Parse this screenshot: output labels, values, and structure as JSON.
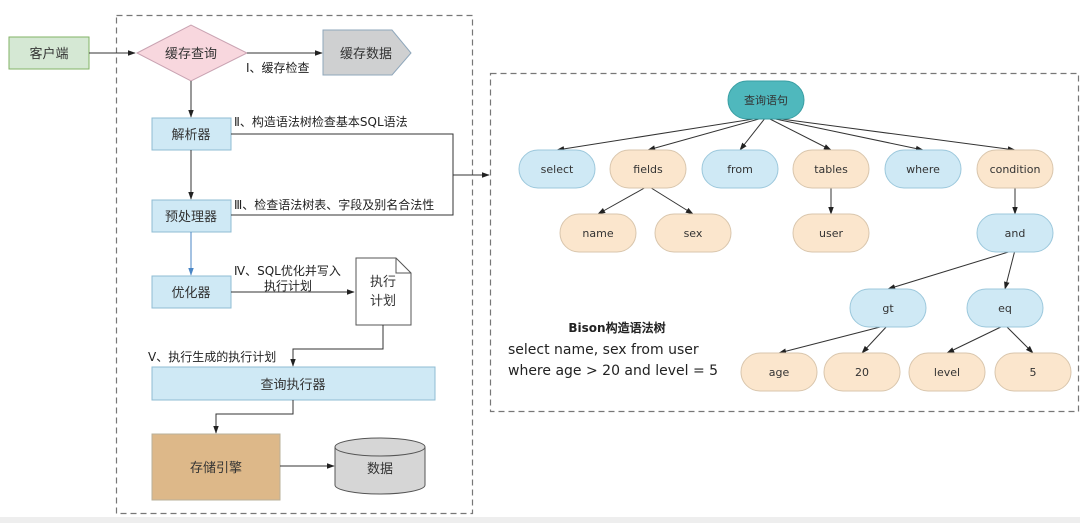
{
  "colors": {
    "client": "#d5e8d4",
    "client_border": "#82b366",
    "cache_query": "#f8d7de",
    "cache_query_border": "#c9a3b2",
    "cache_data": "#cfd0d1",
    "module": "#cfe9f5",
    "module_border": "#8fbcd3",
    "storage": "#ddb889",
    "storage_border": "#b9b09a",
    "db": "#d6d6d6",
    "tree_root": "#4fb8bd",
    "tree_blue": "#cfe9f5",
    "tree_peach": "#fbe6cd",
    "line": "#333333",
    "dash": "#777777"
  },
  "flow": {
    "client": "客户端",
    "cache_query": "缓存查询",
    "cache_data": "缓存数据",
    "parser": "解析器",
    "preprocessor": "预处理器",
    "optimizer": "优化器",
    "exec_plan": [
      "执行",
      "计划"
    ],
    "executor": "查询执行器",
    "storage_engine": "存储引擎",
    "data": "数据"
  },
  "steps": {
    "s1": "Ⅰ、缓存检查",
    "s2": "Ⅱ、构造语法树检查基本SQL语法",
    "s3": "Ⅲ、检查语法树表、字段及别名合法性",
    "s4_line1": "Ⅳ、SQL优化并写入",
    "s4_line2": "执行计划",
    "s5": "Ⅴ、执行生成的执行计划"
  },
  "tree": {
    "root": "查询语句",
    "level1": [
      {
        "label": "select",
        "color": "blue"
      },
      {
        "label": "fields",
        "color": "peach"
      },
      {
        "label": "from",
        "color": "blue"
      },
      {
        "label": "tables",
        "color": "peach"
      },
      {
        "label": "where",
        "color": "blue"
      },
      {
        "label": "condition",
        "color": "peach"
      }
    ],
    "fields_children": [
      "name",
      "sex"
    ],
    "tables_children": [
      "user"
    ],
    "condition_child": "and",
    "and_children": [
      "gt",
      "eq"
    ],
    "gt_children": [
      "age",
      "20"
    ],
    "eq_children": [
      "level",
      "5"
    ]
  },
  "caption": {
    "title": "Bison构造语法树",
    "line1": "select name, sex from user",
    "line2": "where age > 20 and level = 5"
  }
}
